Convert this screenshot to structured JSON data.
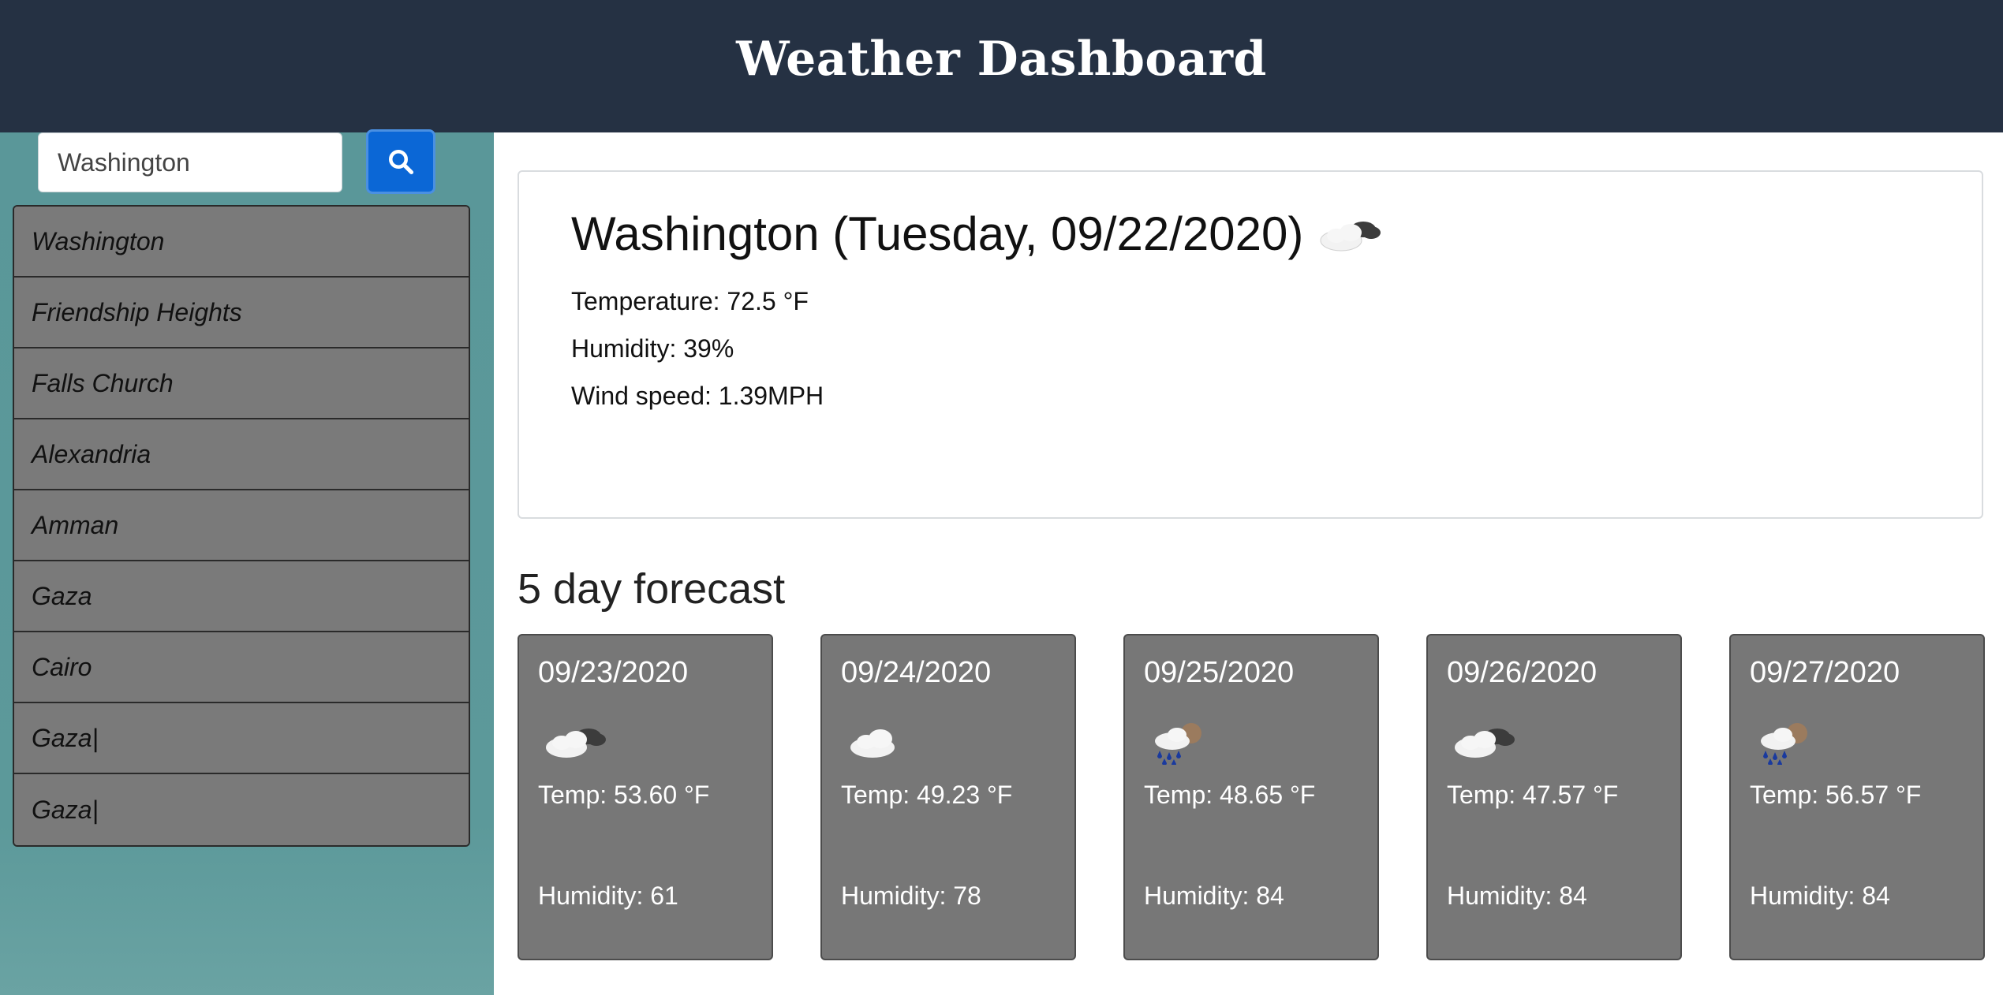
{
  "header": {
    "title": "Weather Dashboard"
  },
  "search": {
    "value": "Washington",
    "button_icon": "search-icon"
  },
  "history": [
    "Washington",
    "Friendship Heights",
    "Falls Church",
    "Alexandria",
    "Amman",
    "Gaza",
    "Cairo",
    "Gaza|",
    "Gaza|"
  ],
  "current": {
    "title": "Washington (Tuesday, 09/22/2020)",
    "icon": "cloudy-icon",
    "temperature": "Temperature: 72.5 °F",
    "humidity": "Humidity: 39%",
    "wind": "Wind speed: 1.39MPH"
  },
  "forecast_title": "5 day forecast",
  "forecast": [
    {
      "date": "09/23/2020",
      "icon": "cloudy-icon",
      "temp": "Temp: 53.60 °F",
      "humidity": "Humidity: 61"
    },
    {
      "date": "09/24/2020",
      "icon": "cloud-icon",
      "temp": "Temp: 49.23 °F",
      "humidity": "Humidity: 78"
    },
    {
      "date": "09/25/2020",
      "icon": "rain-icon",
      "temp": "Temp: 48.65 °F",
      "humidity": "Humidity: 84"
    },
    {
      "date": "09/26/2020",
      "icon": "cloudy-icon",
      "temp": "Temp: 47.57 °F",
      "humidity": "Humidity: 84"
    },
    {
      "date": "09/27/2020",
      "icon": "rain-icon",
      "temp": "Temp: 56.57 °F",
      "humidity": "Humidity: 84"
    }
  ],
  "colors": {
    "header_bg": "#253143",
    "sidebar_bg": "#5a9799",
    "card_bg": "#777777",
    "search_button": "#0b67d6"
  }
}
